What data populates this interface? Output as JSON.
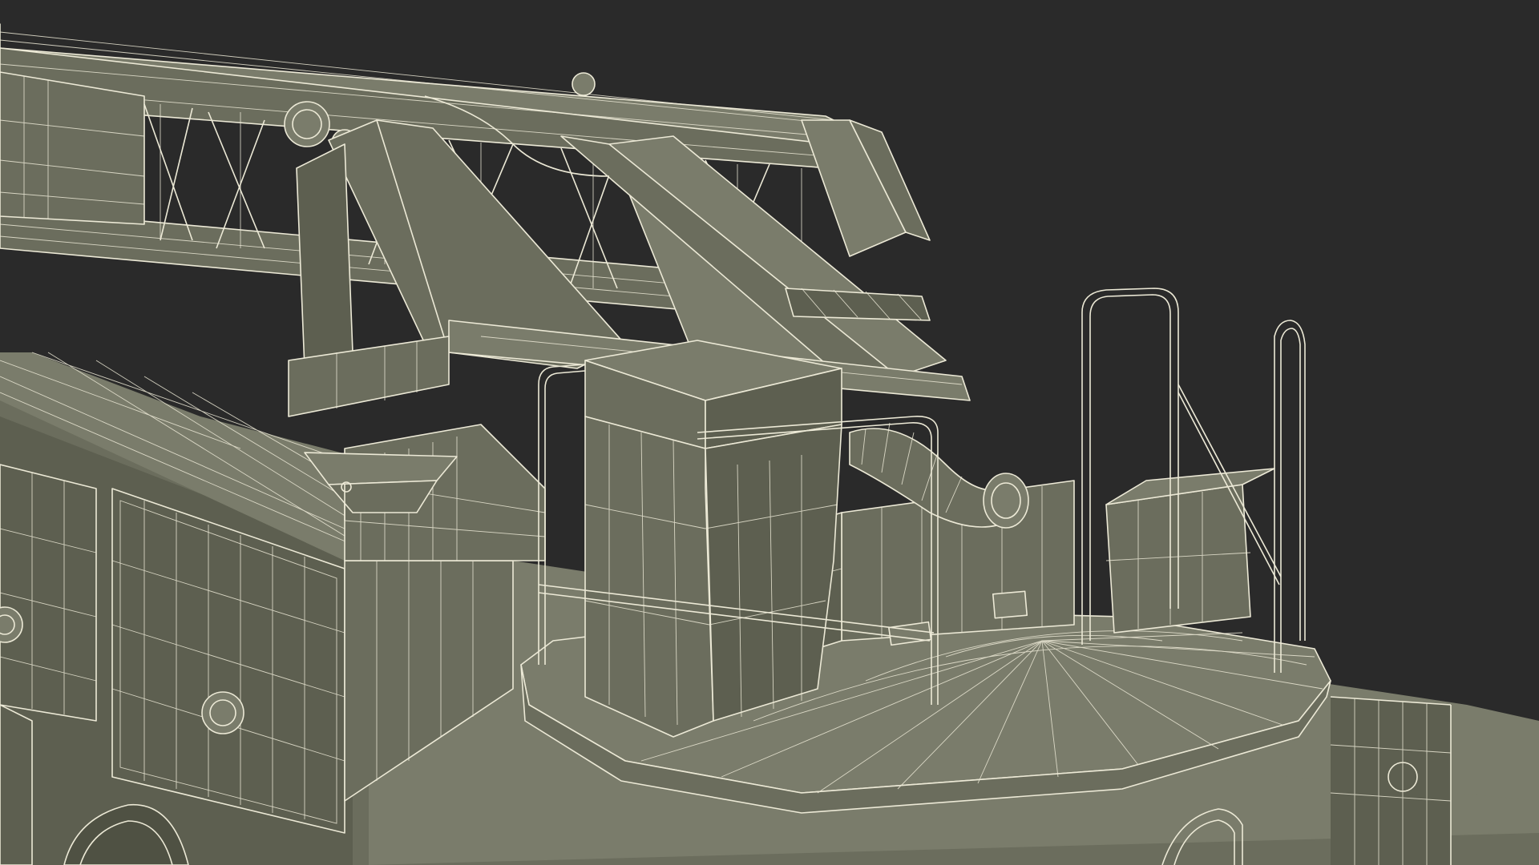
{
  "scene": {
    "subject": "fire-truck-aerial-ladder-turntable-wireframe",
    "colors": {
      "background": "#2a2a2a",
      "surface": "#6b6d5d",
      "surface_dark": "#5d5f50",
      "surface_light": "#7a7c6b",
      "wire": "#ece9d6"
    }
  }
}
